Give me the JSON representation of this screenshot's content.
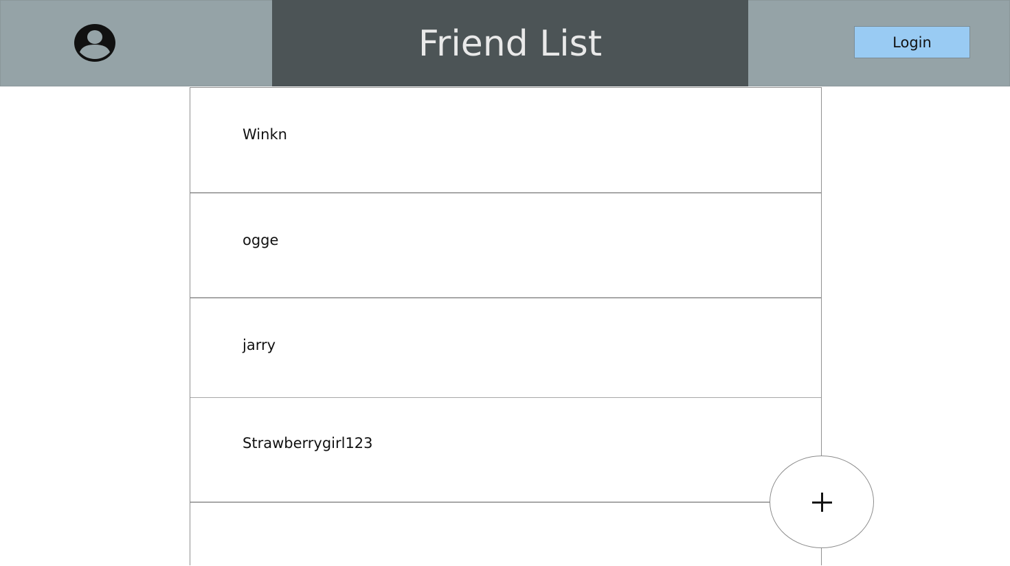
{
  "header": {
    "title": "Friend List",
    "login_label": "Login",
    "avatar_icon": "user-circle-icon",
    "colors": {
      "side_panel": "#95a3a7",
      "center_panel": "#4c5456",
      "login_button": "#99cbf3"
    }
  },
  "friends": [
    {
      "name": "Winkn"
    },
    {
      "name": "ogge"
    },
    {
      "name": "jarry"
    },
    {
      "name": "Strawberrygirl123"
    },
    {
      "name": ""
    }
  ],
  "fab": {
    "icon": "plus-icon"
  }
}
